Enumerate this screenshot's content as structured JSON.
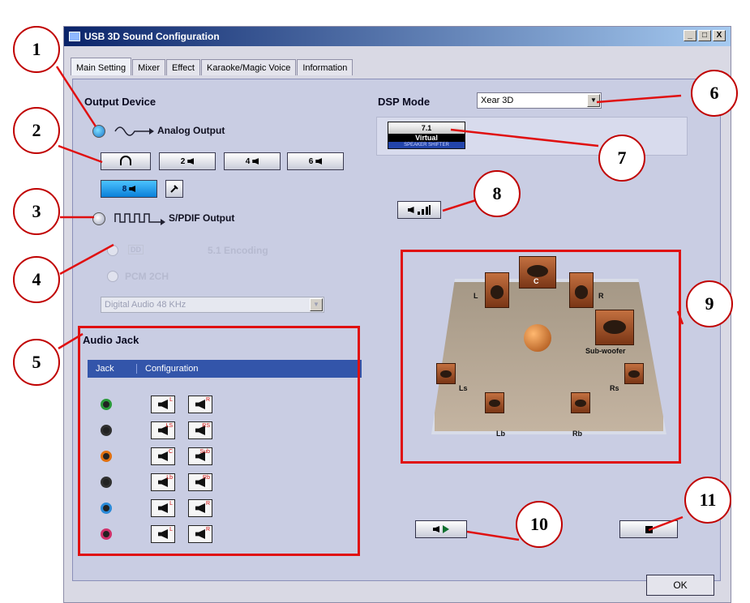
{
  "window": {
    "title": "USB 3D Sound Configuration",
    "buttons": [
      "_",
      "□",
      "X"
    ]
  },
  "tabs": [
    {
      "label": "Main Setting",
      "active": true
    },
    {
      "label": "Mixer",
      "active": false
    },
    {
      "label": "Effect",
      "active": false
    },
    {
      "label": "Karaoke/Magic Voice",
      "active": false
    },
    {
      "label": "Information",
      "active": false
    }
  ],
  "output_device": {
    "title": "Output Device",
    "analog_label": "Analog Output",
    "speaker_buttons": [
      "2",
      "4",
      "6",
      "8"
    ],
    "selected_speaker": "8",
    "spdif_label": "S/PDIF Output",
    "encoding_label": "5.1 Encoding",
    "pcm_label": "PCM 2CH",
    "spdif_rate": "Digital Audio 48 KHz"
  },
  "dsp": {
    "label": "DSP Mode",
    "value": "Xear 3D",
    "badge_top": "7.1",
    "badge_mid": "Virtual",
    "badge_bottom": "SPEAKER SHIFTER"
  },
  "audio_jack": {
    "title": "Audio Jack",
    "col_jack": "Jack",
    "col_config": "Configuration",
    "rows": [
      {
        "color": "#2a9a3a",
        "left": "L",
        "right": "R"
      },
      {
        "color": "#303030",
        "left": "LS",
        "right": "RS"
      },
      {
        "color": "#e07010",
        "left": "C",
        "right": "Sub"
      },
      {
        "color": "#303030",
        "left": "Lb",
        "right": "Rb"
      },
      {
        "color": "#2a8ad8",
        "left": "L",
        "right": "R"
      },
      {
        "color": "#d0306a",
        "left": "L",
        "right": "R"
      }
    ]
  },
  "room": {
    "labels": {
      "l": "L",
      "c": "C",
      "r": "R",
      "sub": "Sub-woofer",
      "ls": "Ls",
      "rs": "Rs",
      "lb": "Lb",
      "rb": "Rb"
    }
  },
  "callouts": [
    "1",
    "2",
    "3",
    "4",
    "5",
    "6",
    "7",
    "8",
    "9",
    "10",
    "11"
  ],
  "ok_label": "OK",
  "colors": {
    "highlight": "#e01010",
    "panel": "#c9cde3",
    "table_header": "#3355aa"
  }
}
